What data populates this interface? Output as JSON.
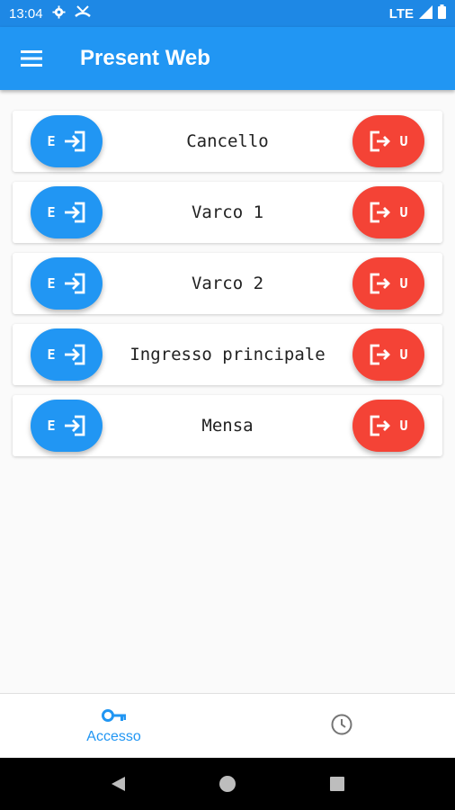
{
  "status_bar": {
    "time": "13:04",
    "network": "LTE",
    "left_icons": [
      "gear-icon",
      "missed-call-icon"
    ],
    "right_icons": [
      "signal-icon",
      "battery-icon"
    ]
  },
  "app_bar": {
    "title": "Present Web",
    "menu_icon": "hamburger-menu-icon"
  },
  "colors": {
    "primary": "#2196f3",
    "status_bar": "#1e88e5",
    "entry": "#2196f3",
    "exit": "#f44336",
    "background": "#fafafa"
  },
  "gates": [
    {
      "name": "Cancello",
      "entry_label": "E",
      "exit_label": "U"
    },
    {
      "name": "Varco 1",
      "entry_label": "E",
      "exit_label": "U"
    },
    {
      "name": "Varco 2",
      "entry_label": "E",
      "exit_label": "U"
    },
    {
      "name": "Ingresso principale",
      "entry_label": "E",
      "exit_label": "U"
    },
    {
      "name": "Mensa",
      "entry_label": "E",
      "exit_label": "U"
    }
  ],
  "bottom_nav": {
    "items": [
      {
        "label": "Accesso",
        "icon": "key-icon",
        "active": true
      },
      {
        "label": "",
        "icon": "clock-icon",
        "active": false
      }
    ]
  },
  "system_nav": {
    "buttons": [
      "back-icon",
      "home-icon",
      "recents-icon"
    ]
  }
}
